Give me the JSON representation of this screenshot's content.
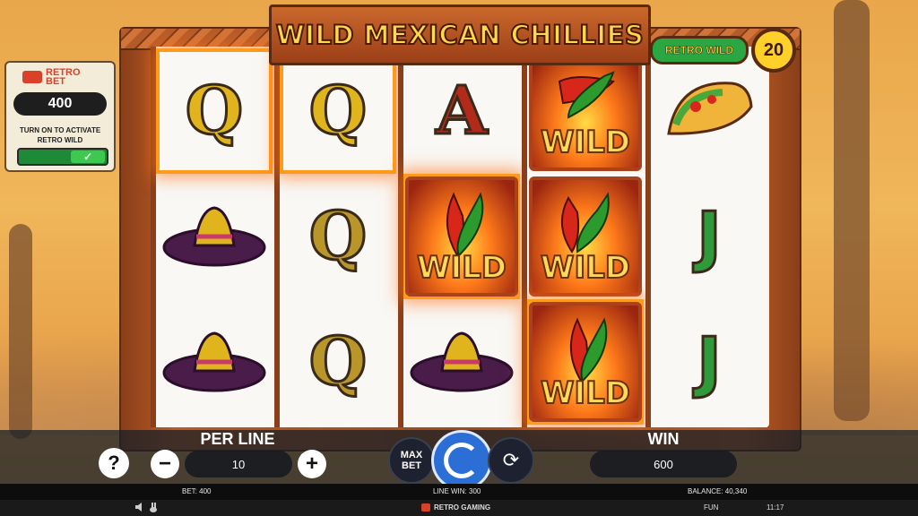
{
  "game": {
    "title": "WILD MEXICAN CHILLIES",
    "retro_wild_badge": "RETRO WILD",
    "lines_count": "20"
  },
  "retro_bet": {
    "logo_text": "RETRO BET",
    "value": "400",
    "instruction": "TURN ON TO ACTIVATE RETRO WILD",
    "toggle_on": true
  },
  "reels": [
    [
      "Q",
      "sombrero",
      "sombrero"
    ],
    [
      "Q",
      "Q",
      "Q"
    ],
    [
      "A",
      "WILD",
      "sombrero"
    ],
    [
      "WILD",
      "WILD",
      "WILD"
    ],
    [
      "taco",
      "J",
      "J"
    ]
  ],
  "wild_label": "WILD",
  "controls": {
    "help_label": "?",
    "per_line_label": "PER LINE",
    "per_line_value": "10",
    "minus_label": "−",
    "plus_label": "+",
    "max_bet_label": "MAX BET",
    "win_label": "WIN",
    "win_value": "600"
  },
  "status": {
    "bet": "BET: 400",
    "line_win": "LINE WIN: 300",
    "balance": "BALANCE: 40,340"
  },
  "footer": {
    "brand": "RETRO GAMING",
    "mode": "FUN",
    "time": "11:17"
  },
  "colors": {
    "frame": "#9c4a1e",
    "title_gold": "#ffd74a",
    "retro_wild_green": "#2aa642",
    "spin_blue": "#2b6fd6",
    "highlight_orange": "#ff9b1a"
  }
}
